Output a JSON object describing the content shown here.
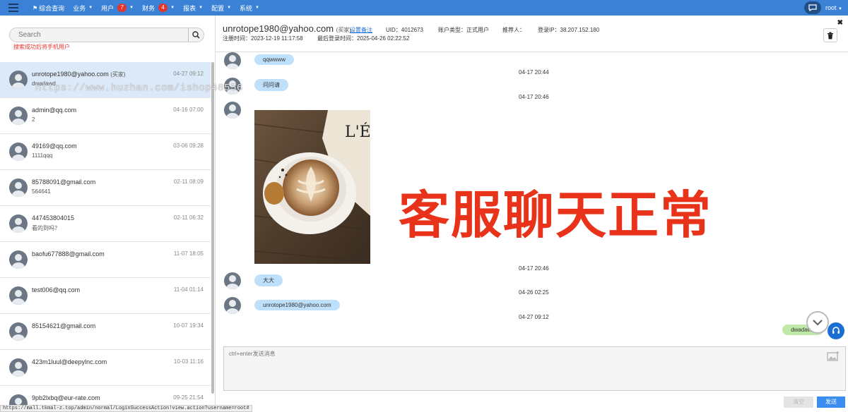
{
  "nav": {
    "items": [
      {
        "label": "综合查询",
        "badge": null
      },
      {
        "label": "业务",
        "badge": null
      },
      {
        "label": "用户",
        "badge": "7"
      },
      {
        "label": "财务",
        "badge": "4"
      },
      {
        "label": "报表",
        "badge": null
      },
      {
        "label": "配置",
        "badge": null
      },
      {
        "label": "系统",
        "badge": null
      }
    ],
    "user": "root"
  },
  "search": {
    "placeholder": "Search",
    "hint": "搜索成功后将手机用户"
  },
  "conversations": [
    {
      "name": "unrotope1980@yahoo.com",
      "tag": "(买家)",
      "preview": "dwadawd",
      "time": "04-27 09:12",
      "active": true
    },
    {
      "name": "admin@qq.com",
      "tag": "",
      "preview": "2",
      "time": "04-16 07:00",
      "active": false
    },
    {
      "name": "49169@qq.com",
      "tag": "",
      "preview": "1111qqq",
      "time": "03-06 09:28",
      "active": false
    },
    {
      "name": "85788091@gmail.com",
      "tag": "",
      "preview": "564641",
      "time": "02-11 08:09",
      "active": false
    },
    {
      "name": "447453804015",
      "tag": "",
      "preview": "看的到吗？",
      "time": "02-11 06:32",
      "active": false
    },
    {
      "name": "baofu677888@gmail.com",
      "tag": "",
      "preview": "",
      "time": "11-07 18:05",
      "active": false
    },
    {
      "name": "test006@qq.com",
      "tag": "",
      "preview": "",
      "time": "11-04 01:14",
      "active": false
    },
    {
      "name": "85154621@gmail.com",
      "tag": "",
      "preview": "",
      "time": "10-07 19:34",
      "active": false
    },
    {
      "name": "423m1luul@deepylnc.com",
      "tag": "",
      "preview": "",
      "time": "10-03 11:16",
      "active": false
    },
    {
      "name": "9pb2lxbq@eur-rate.com",
      "tag": "",
      "preview": "",
      "time": "09-25 21:54",
      "active": false
    }
  ],
  "status_url": "https://mall.tkmal-z.top/admin/normal/LoginSuccessAction!view.action?username=root#",
  "header": {
    "name": "unrotope1980@yahoo.com",
    "tag": "(买家)",
    "remark": "设置备注",
    "uid": "UID：4012673",
    "account_type": "账户类型：正式用户",
    "referrer": "推荐人：",
    "login_ip": "登录IP：38.207.152.180",
    "register_time": "注册时间：2023-12-19 11:17:58",
    "last_login": "最后登录时间：2025-04-26 02:22:52"
  },
  "messages": {
    "m1": "qqwwww",
    "t1": "04-17 20:44",
    "m2": "问问请",
    "t2": "04-17 20:46",
    "t3": "04-17 20:46",
    "m4": "大大",
    "t4": "04-26 02:25",
    "m5": "unrotope1980@yahoo.com",
    "t5": "04-27 09:12",
    "self1": "dwadawd"
  },
  "overlay_text": "客服聊天正常",
  "watermark": "https://www.huzhan.com/ishop48556",
  "photo": {
    "cafe_sign": "L'ÉP"
  },
  "input": {
    "placeholder": "ctrl+enter发送消息",
    "clear_label": "清空",
    "send_label": "发送"
  },
  "colors": {
    "nav_bg": "#3b82d6",
    "bubble_other": "#bfe0fb",
    "bubble_self": "#bfe9a8",
    "overlay_red": "#e8331a",
    "send_button": "#3b8ef0"
  }
}
